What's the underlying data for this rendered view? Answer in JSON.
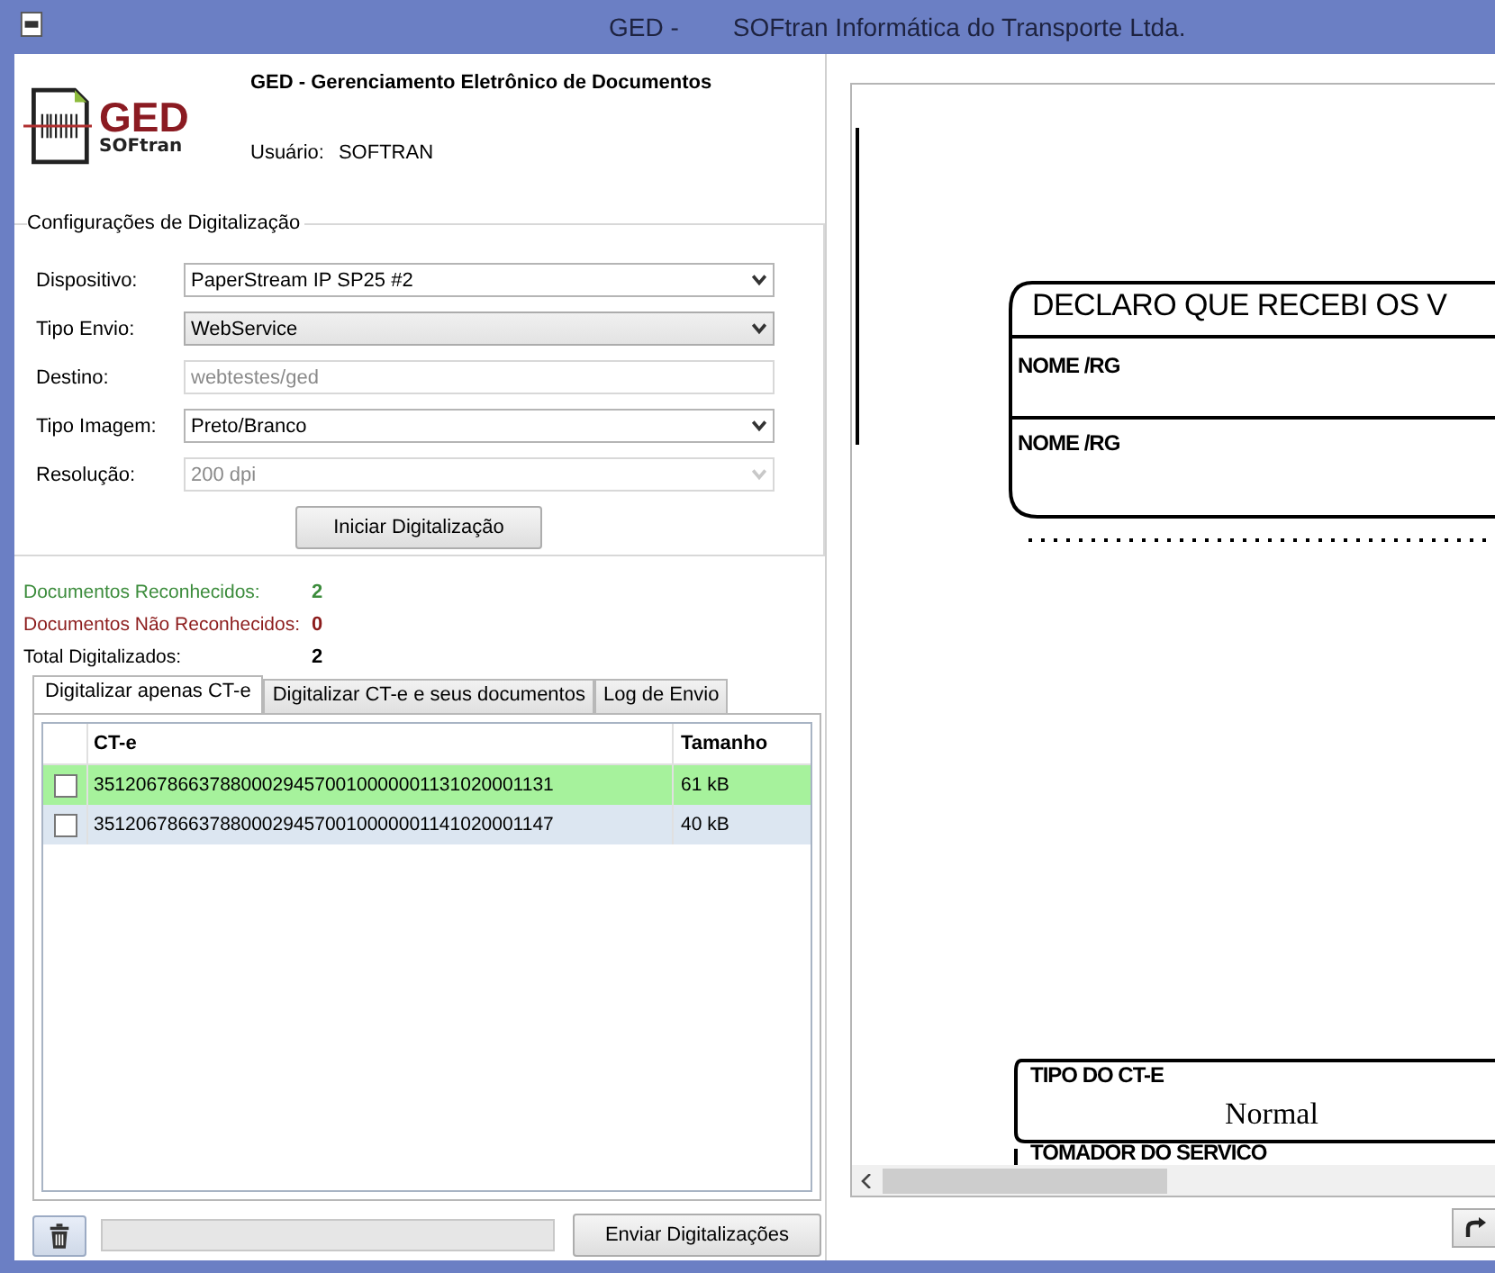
{
  "window": {
    "title_parts": [
      "GED -",
      "SOFtran Informática do Transporte Ltda."
    ]
  },
  "header": {
    "logo_text": "GED",
    "logo_subtext": "SOFtran",
    "title": "GED - Gerenciamento Eletrônico de Documentos",
    "user_label": "Usuário:",
    "user": "SOFTRAN"
  },
  "settings": {
    "title": "Configurações de Digitalização",
    "fields": [
      {
        "label": "Dispositivo:",
        "kind": "dropdown",
        "value": "PaperStream IP SP25 #2",
        "disabled": false
      },
      {
        "label": "Tipo Envio:",
        "kind": "combo",
        "value": "WebService",
        "disabled": false
      },
      {
        "label": "Destino:",
        "kind": "text",
        "value": "webtestes/ged",
        "disabled": true
      },
      {
        "label": "Tipo Imagem:",
        "kind": "dropdown",
        "value": "Preto/Branco",
        "disabled": false
      },
      {
        "label": "Resolução:",
        "kind": "dropdown",
        "value": "200 dpi",
        "disabled": true
      }
    ],
    "button": "Iniciar Digitalização"
  },
  "stats": [
    {
      "label": "Documentos Reconhecidos:",
      "value": "2",
      "color": "#3c8c3c"
    },
    {
      "label": "Documentos Não Reconhecidos:",
      "value": "0",
      "color": "#8c1c1c"
    },
    {
      "label": "Total Digitalizados:",
      "value": "2",
      "color": "#000000"
    }
  ],
  "tabs": [
    {
      "label": "Digitalizar apenas CT-e",
      "selected": true
    },
    {
      "label": "Digitalizar CT-e e seus documentos",
      "selected": false
    },
    {
      "label": "Log de Envio",
      "selected": false
    }
  ],
  "table": {
    "columns": [
      "CT-e",
      "Tamanho"
    ],
    "rows": [
      {
        "checked": false,
        "color": "#a6f29c",
        "cells": [
          "35120678663788000294570010000001131020001131",
          "61 kB"
        ]
      },
      {
        "checked": false,
        "color": "#dce6f1",
        "cells": [
          "35120678663788000294570010000001141020001147",
          "40 kB"
        ]
      }
    ]
  },
  "footer": {
    "send_button": "Enviar Digitalizações",
    "progress": {
      "level": 0
    }
  },
  "document": {
    "texts": [
      {
        "kind": "heading",
        "text": "DECLARO QUE RECEBI OS V"
      },
      {
        "kind": "label",
        "text": "NOME /RG"
      },
      {
        "kind": "label",
        "text": "NOME /RG"
      },
      {
        "kind": "label",
        "text": "TIPO DO CT-E"
      },
      {
        "kind": "value",
        "text": "Normal"
      },
      {
        "kind": "label",
        "text": "TOMADOR DO SERVICO"
      }
    ]
  }
}
